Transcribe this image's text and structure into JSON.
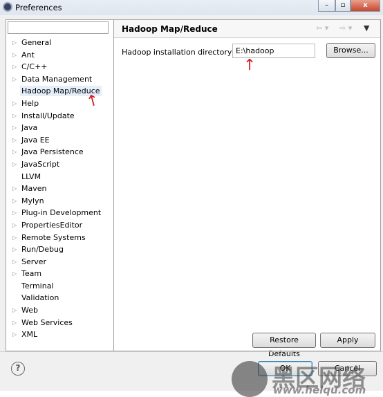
{
  "window": {
    "title": "Preferences",
    "minimize": "–",
    "maximize": "▫",
    "close": "x"
  },
  "search": {
    "value": "",
    "placeholder": ""
  },
  "tree": [
    {
      "label": "General",
      "expandable": true
    },
    {
      "label": "Ant",
      "expandable": true
    },
    {
      "label": "C/C++",
      "expandable": true
    },
    {
      "label": "Data Management",
      "expandable": true
    },
    {
      "label": "Hadoop Map/Reduce",
      "expandable": false,
      "selected": true
    },
    {
      "label": "Help",
      "expandable": true
    },
    {
      "label": "Install/Update",
      "expandable": true
    },
    {
      "label": "Java",
      "expandable": true
    },
    {
      "label": "Java EE",
      "expandable": true
    },
    {
      "label": "Java Persistence",
      "expandable": true
    },
    {
      "label": "JavaScript",
      "expandable": true
    },
    {
      "label": "LLVM",
      "expandable": false
    },
    {
      "label": "Maven",
      "expandable": true
    },
    {
      "label": "Mylyn",
      "expandable": true
    },
    {
      "label": "Plug-in Development",
      "expandable": true
    },
    {
      "label": "PropertiesEditor",
      "expandable": true
    },
    {
      "label": "Remote Systems",
      "expandable": true
    },
    {
      "label": "Run/Debug",
      "expandable": true
    },
    {
      "label": "Server",
      "expandable": true
    },
    {
      "label": "Team",
      "expandable": true
    },
    {
      "label": "Terminal",
      "expandable": false
    },
    {
      "label": "Validation",
      "expandable": false
    },
    {
      "label": "Web",
      "expandable": true
    },
    {
      "label": "Web Services",
      "expandable": true
    },
    {
      "label": "XML",
      "expandable": true
    }
  ],
  "page": {
    "title": "Hadoop Map/Reduce",
    "dir_label": "Hadoop installation directory:",
    "dir_value": "E:\\hadoop",
    "browse": "Browse...",
    "restore_defaults": "Restore Defaults",
    "apply": "Apply"
  },
  "footer": {
    "ok": "OK",
    "cancel": "Cancel",
    "help": "?"
  },
  "annotation_arrows": "↑",
  "watermark": {
    "text": "黑区网络",
    "url": "www.heiqu.com"
  },
  "colors": {
    "accent": "#3c7fb1",
    "arrow": "#d02020",
    "selection": "#e5eef9"
  }
}
